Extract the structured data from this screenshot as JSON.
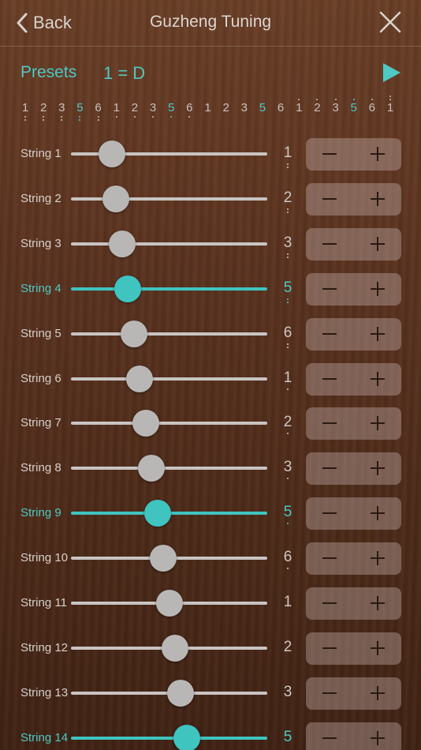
{
  "header": {
    "back_label": "Back",
    "title": "Guzheng Tuning",
    "back_icon": "chevron-left-icon",
    "close_icon": "close-icon"
  },
  "presets": {
    "label": "Presets",
    "key": "1 = D",
    "play_icon": "play-icon"
  },
  "colors": {
    "accent": "#4fc8c4",
    "wood_dark": "#4c2a19",
    "track": "#c8c4c2",
    "thumb": "#b9b7b6"
  },
  "notation": [
    {
      "n": "1",
      "oct": -2,
      "hl": false
    },
    {
      "n": "2",
      "oct": -2,
      "hl": false
    },
    {
      "n": "3",
      "oct": -2,
      "hl": false
    },
    {
      "n": "5",
      "oct": -2,
      "hl": true
    },
    {
      "n": "6",
      "oct": -2,
      "hl": false
    },
    {
      "n": "1",
      "oct": -1,
      "hl": false
    },
    {
      "n": "2",
      "oct": -1,
      "hl": false
    },
    {
      "n": "3",
      "oct": -1,
      "hl": false
    },
    {
      "n": "5",
      "oct": -1,
      "hl": true
    },
    {
      "n": "6",
      "oct": -1,
      "hl": false
    },
    {
      "n": "1",
      "oct": 0,
      "hl": false
    },
    {
      "n": "2",
      "oct": 0,
      "hl": false
    },
    {
      "n": "3",
      "oct": 0,
      "hl": false
    },
    {
      "n": "5",
      "oct": 0,
      "hl": true
    },
    {
      "n": "6",
      "oct": 0,
      "hl": false
    },
    {
      "n": "1",
      "oct": 1,
      "hl": false
    },
    {
      "n": "2",
      "oct": 1,
      "hl": false
    },
    {
      "n": "3",
      "oct": 1,
      "hl": false
    },
    {
      "n": "5",
      "oct": 1,
      "hl": true
    },
    {
      "n": "6",
      "oct": 1,
      "hl": false
    },
    {
      "n": "1",
      "oct": 2,
      "hl": false
    }
  ],
  "strings": [
    {
      "label": "String 1",
      "note": "1",
      "oct": -2,
      "active": false,
      "level": 0.21
    },
    {
      "label": "String 2",
      "note": "2",
      "oct": -2,
      "active": false,
      "level": 0.23
    },
    {
      "label": "String 3",
      "note": "3",
      "oct": -2,
      "active": false,
      "level": 0.26
    },
    {
      "label": "String 4",
      "note": "5",
      "oct": -2,
      "active": true,
      "level": 0.29
    },
    {
      "label": "String 5",
      "note": "6",
      "oct": -2,
      "active": false,
      "level": 0.32
    },
    {
      "label": "String 6",
      "note": "1",
      "oct": -1,
      "active": false,
      "level": 0.35
    },
    {
      "label": "String 7",
      "note": "2",
      "oct": -1,
      "active": false,
      "level": 0.38
    },
    {
      "label": "String 8",
      "note": "3",
      "oct": -1,
      "active": false,
      "level": 0.41
    },
    {
      "label": "String 9",
      "note": "5",
      "oct": -1,
      "active": true,
      "level": 0.44
    },
    {
      "label": "String 10",
      "note": "6",
      "oct": -1,
      "active": false,
      "level": 0.47
    },
    {
      "label": "String 11",
      "note": "1",
      "oct": 0,
      "active": false,
      "level": 0.5
    },
    {
      "label": "String 12",
      "note": "2",
      "oct": 0,
      "active": false,
      "level": 0.53
    },
    {
      "label": "String 13",
      "note": "3",
      "oct": 0,
      "active": false,
      "level": 0.56
    },
    {
      "label": "String 14",
      "note": "5",
      "oct": 0,
      "active": true,
      "level": 0.59
    }
  ],
  "stepper": {
    "minus_icon": "minus-icon",
    "plus_icon": "plus-icon"
  }
}
